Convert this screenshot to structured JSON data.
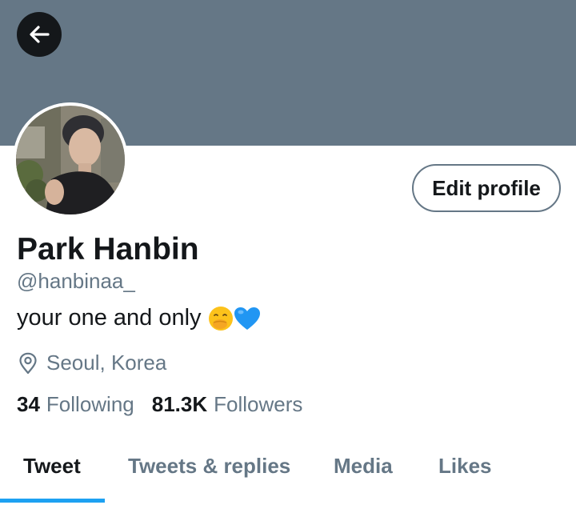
{
  "header": {
    "back_icon": "arrow-left-icon",
    "banner_color": "#657786"
  },
  "profile": {
    "display_name": "Park Hanbin",
    "handle": "@hanbinaa_",
    "bio_text": "your one and only",
    "bio_emoji": [
      "face-with-hand-over-mouth-emoji",
      "blue-heart-emoji"
    ],
    "location": "Seoul, Korea",
    "location_icon": "location-pin-icon",
    "edit_profile_label": "Edit profile"
  },
  "stats": {
    "following_count": "34",
    "following_label": "Following",
    "followers_count": "81.3K",
    "followers_label": "Followers"
  },
  "tabs": [
    {
      "label": "Tweet",
      "active": true
    },
    {
      "label": "Tweets & replies",
      "active": false
    },
    {
      "label": "Media",
      "active": false
    },
    {
      "label": "Likes",
      "active": false
    }
  ],
  "colors": {
    "accent": "#1da1f2",
    "text_primary": "#14171a",
    "text_secondary": "#657786"
  }
}
